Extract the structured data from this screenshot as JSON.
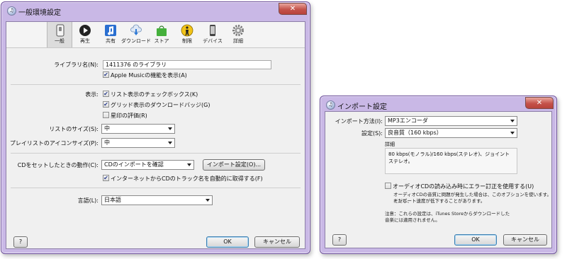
{
  "general_window": {
    "title": "一般環境設定",
    "close_glyph": "✕",
    "help_label": "?",
    "toolbar": [
      {
        "label": "一般",
        "icon": "general-switch-icon",
        "selected": true
      },
      {
        "label": "再生",
        "icon": "play-icon",
        "selected": false
      },
      {
        "label": "共有",
        "icon": "music-note-icon",
        "selected": false
      },
      {
        "label": "ダウンロード",
        "icon": "cloud-download-icon",
        "selected": false
      },
      {
        "label": "ストア",
        "icon": "shopping-bag-icon",
        "selected": false
      },
      {
        "label": "制限",
        "icon": "parental-restriction-icon",
        "selected": false
      },
      {
        "label": "デバイス",
        "icon": "device-icon",
        "selected": false
      },
      {
        "label": "詳細",
        "icon": "gear-icon",
        "selected": false
      }
    ],
    "library_name_label": "ライブラリ名(N):",
    "library_name_value": "1411376 のライブラリ",
    "apple_music_label": "Apple Musicの機能を表示(A)",
    "apple_music_checked": true,
    "display_label": "表示:",
    "list_checkbox_label": "リスト表示のチェックボックス(K)",
    "list_checkbox_checked": true,
    "grid_badge_label": "グリッド表示のダウンロードバッジ(G)",
    "grid_badge_checked": true,
    "star_rating_label": "星印の評価(R)",
    "star_rating_checked": false,
    "list_size_label": "リストのサイズ(S):",
    "list_size_value": "中",
    "playlist_icon_size_label": "プレイリストのアイコンサイズ(P):",
    "playlist_icon_size_value": "中",
    "cd_insert_label": "CDをセットしたときの動作(C):",
    "cd_insert_value": "CDのインポートを確認",
    "import_settings_button": "インポート設定(O)...",
    "auto_track_names_label": "インターネットからCDのトラック名を自動的に取得する(F)",
    "auto_track_names_checked": true,
    "language_label": "言語(L):",
    "language_value": "日本語",
    "ok_button": "OK",
    "cancel_button": "キャンセル"
  },
  "import_window": {
    "title": "インポート設定",
    "close_glyph": "✕",
    "help_label": "?",
    "import_using_label": "インポート方法(I):",
    "import_using_value": "MP3エンコーダ",
    "setting_label": "設定(S):",
    "setting_value": "良音質（160 kbps）",
    "details_label": "詳細",
    "details_text": "80 kbps(モノラル)/160 kbps(ステレオ)、ジョイントステレオ。",
    "error_correction_label": "オーディオCDの読み込み時にエラー訂正を使用する(U)",
    "error_correction_checked": false,
    "error_correction_note_1": "オーディオCDの音質に問題が発生した場合は、このオプションを使います。ただし、",
    "error_correction_note_2": "インポート速度が低下することがあります。",
    "note_1": "注意：これらの設定は、iTunes Storeからダウンロードした",
    "note_2": "音楽には適用されません。",
    "ok_button": "OK",
    "cancel_button": "キャンセル"
  },
  "colors": {
    "window_frame": "#c9b8e6",
    "client_background": "#f0f0f0",
    "close_button": "#c4524a",
    "default_button_border": "#3c7fb1"
  }
}
